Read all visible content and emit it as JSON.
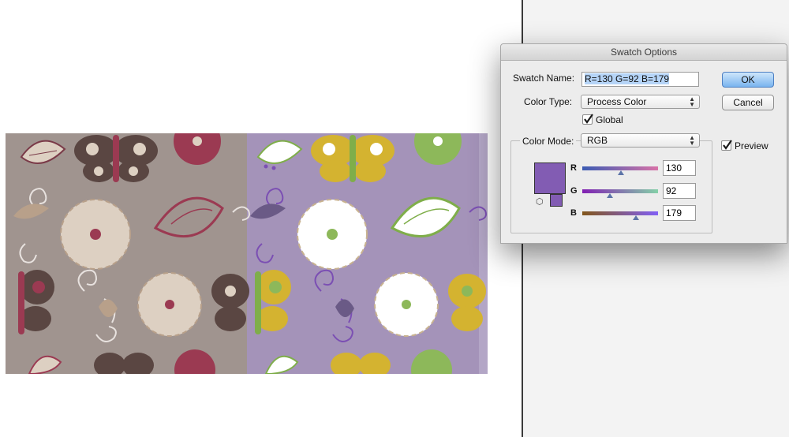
{
  "dialog": {
    "title": "Swatch Options",
    "swatch_name_label": "Swatch Name:",
    "swatch_name_value": "R=130 G=92 B=179",
    "color_type_label": "Color Type:",
    "color_type_value": "Process Color",
    "global_label": "Global",
    "global_checked": true,
    "color_mode_label": "Color Mode:",
    "color_mode_value": "RGB",
    "preview_label": "Preview",
    "preview_checked": true,
    "ok_label": "OK",
    "cancel_label": "Cancel",
    "swatch_color": "#825cb3",
    "channels": [
      {
        "label": "R",
        "value": "130"
      },
      {
        "label": "G",
        "value": "92"
      },
      {
        "label": "B",
        "value": "179"
      }
    ]
  },
  "colors": {
    "pattern_original_bg": "#a0948f",
    "pattern_recolored_bg": "#a493b9",
    "accent_purple": "#825cb3"
  }
}
